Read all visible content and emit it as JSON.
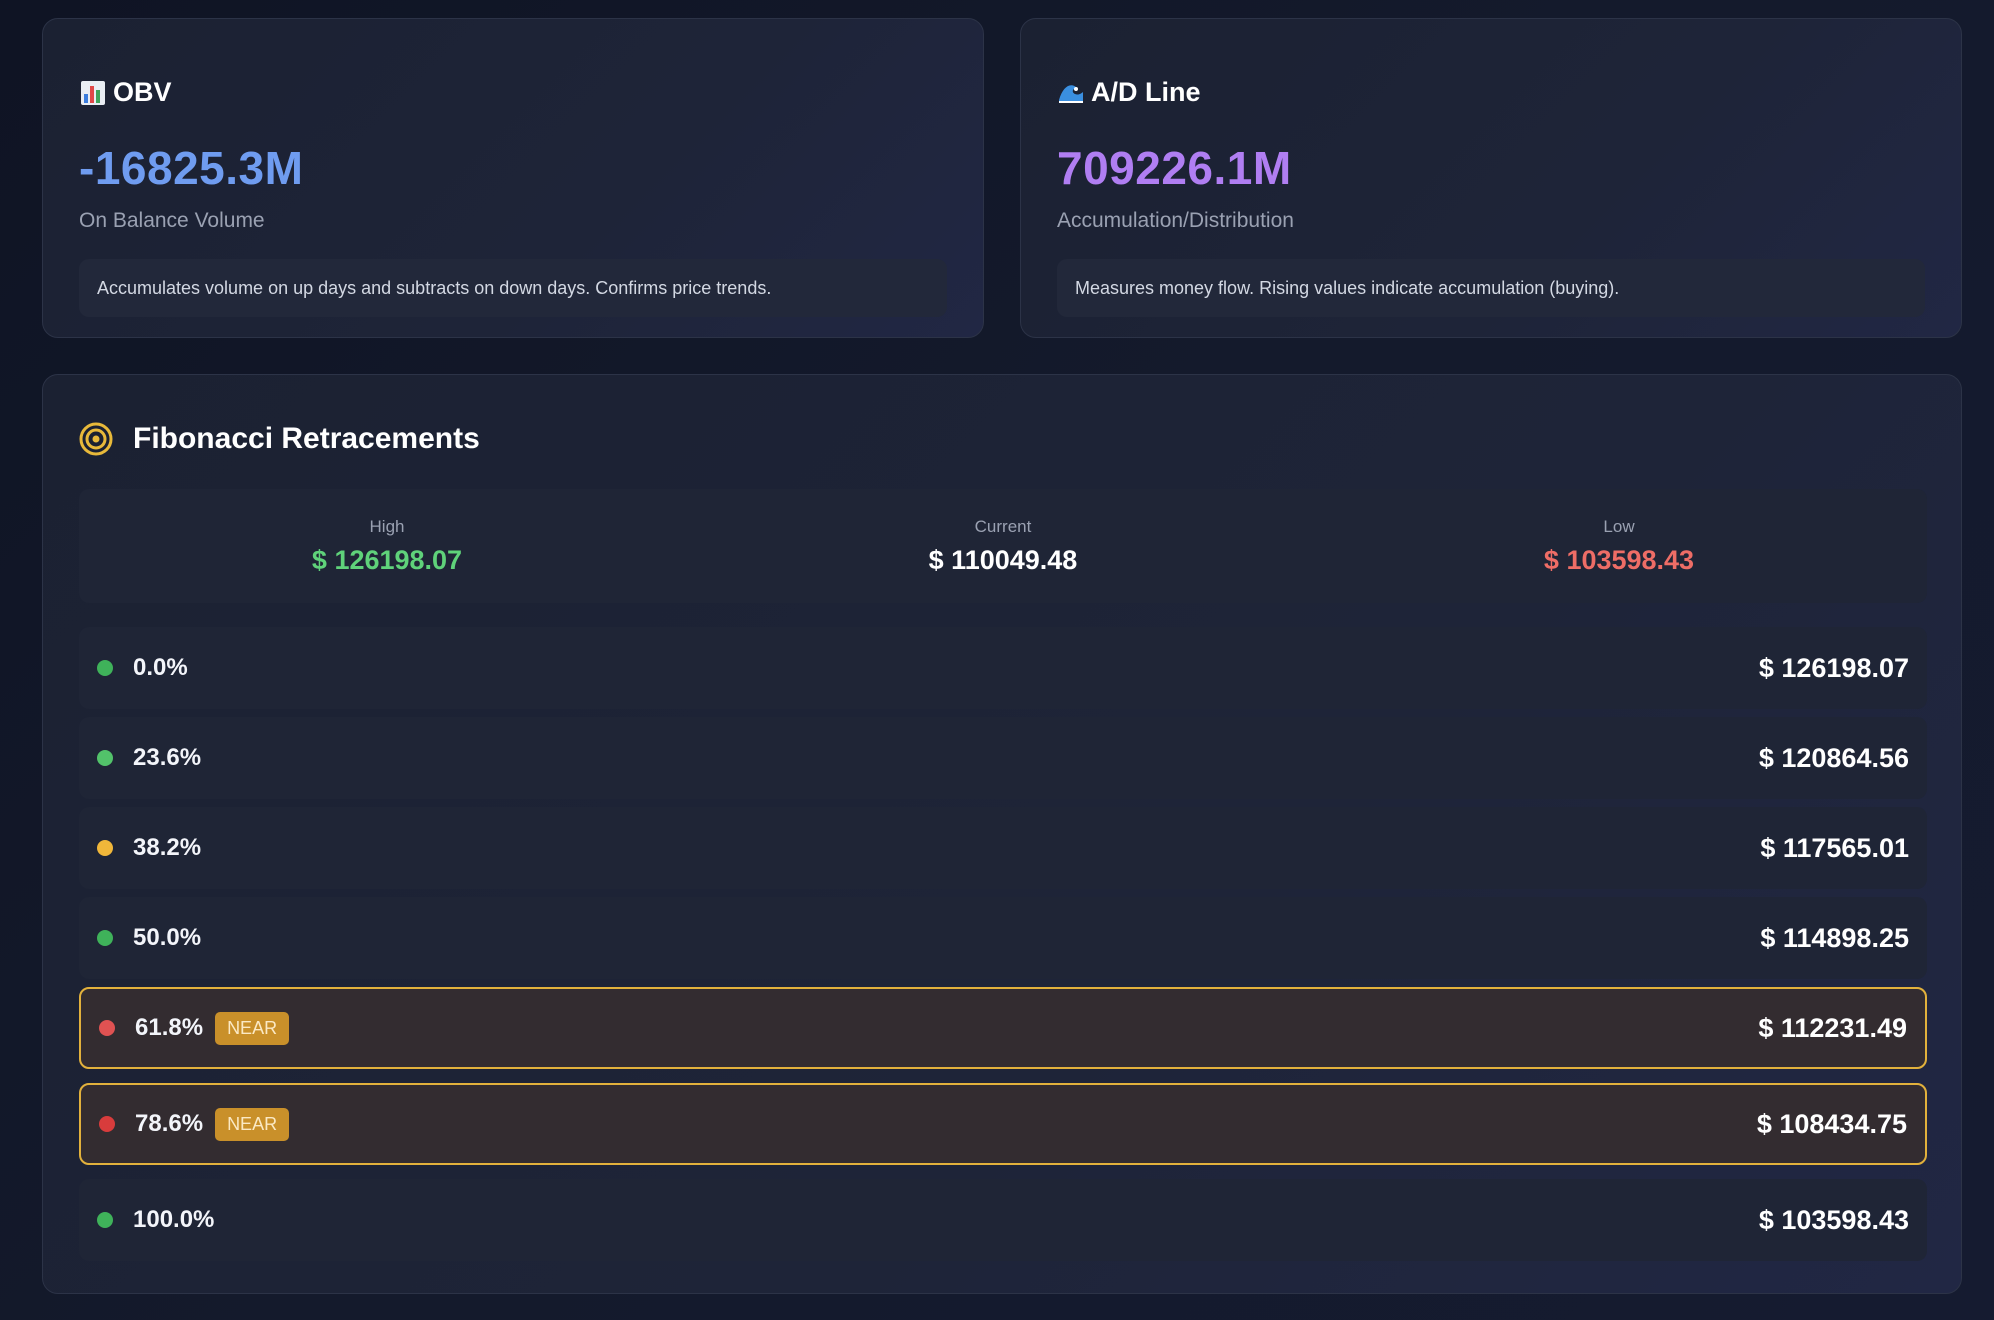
{
  "obv": {
    "icon": "bar-chart-icon",
    "title": "OBV",
    "value": "-16825.3M",
    "subtitle": "On Balance Volume",
    "description": "Accumulates volume on up days and subtracts on down days. Confirms price trends.",
    "color": "#6f9cf0"
  },
  "ad": {
    "icon": "wave-icon",
    "title": "A/D Line",
    "value": "709226.1M",
    "subtitle": "Accumulation/Distribution",
    "description": "Measures money flow. Rising values indicate accumulation (buying).",
    "color": "#b07ef2"
  },
  "fibonacci": {
    "icon": "target-icon",
    "title": "Fibonacci Retracements",
    "summary": {
      "high_label": "High",
      "high_value": "$ 126198.07",
      "current_label": "Current",
      "current_value": "$ 110049.48",
      "low_label": "Low",
      "low_value": "$ 103598.43"
    },
    "near_label": "NEAR",
    "levels": [
      {
        "pct": "0.0%",
        "price": "$ 126198.07",
        "dot_color": "#3fb25a",
        "near": false
      },
      {
        "pct": "23.6%",
        "price": "$ 120864.56",
        "dot_color": "#52c26a",
        "near": false
      },
      {
        "pct": "38.2%",
        "price": "$ 117565.01",
        "dot_color": "#f0b73a",
        "near": false
      },
      {
        "pct": "50.0%",
        "price": "$ 114898.25",
        "dot_color": "#3fb25a",
        "near": false
      },
      {
        "pct": "61.8%",
        "price": "$ 112231.49",
        "dot_color": "#e05252",
        "near": true
      },
      {
        "pct": "78.6%",
        "price": "$ 108434.75",
        "dot_color": "#d83c3c",
        "near": true
      },
      {
        "pct": "100.0%",
        "price": "$ 103598.43",
        "dot_color": "#3fb25a",
        "near": false
      }
    ]
  },
  "colors": {
    "high": "#5fd27a",
    "low": "#ee6d66",
    "near_border": "#e2b13c",
    "near_badge": "#c9902a"
  }
}
